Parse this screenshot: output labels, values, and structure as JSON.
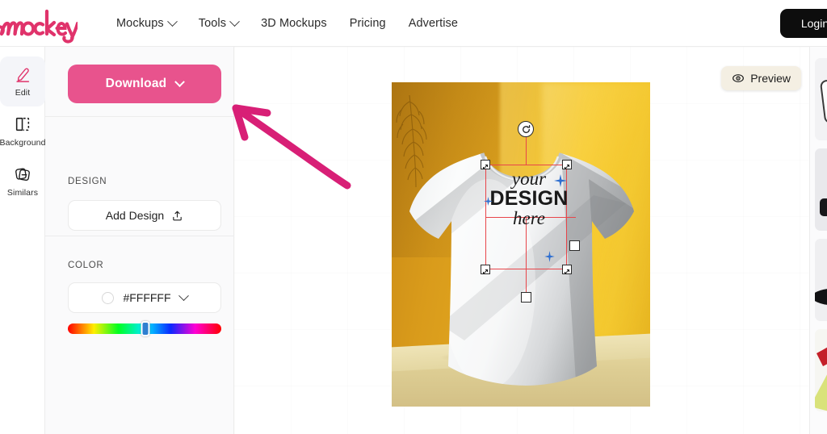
{
  "header": {
    "logo_text": "mockey",
    "nav": [
      {
        "label": "Mockups",
        "has_caret": true
      },
      {
        "label": "Tools",
        "has_caret": true
      },
      {
        "label": "3D Mockups",
        "has_caret": false
      },
      {
        "label": "Pricing",
        "has_caret": false
      },
      {
        "label": "Advertise",
        "has_caret": false
      }
    ],
    "login_label": "Login"
  },
  "rail": {
    "items": [
      {
        "label": "Edit",
        "icon": "pencil-icon",
        "active": true
      },
      {
        "label": "Background",
        "icon": "background-icon",
        "active": false
      },
      {
        "label": "Similars",
        "icon": "similars-icon",
        "active": false
      }
    ]
  },
  "panel": {
    "download_label": "Download",
    "design_section_label": "DESIGN",
    "add_design_label": "Add Design",
    "color_section_label": "COLOR",
    "color_value": "#FFFFFF",
    "hue_position_percent": 52
  },
  "canvas": {
    "preview_label": "Preview",
    "design_placeholder": {
      "line1": "your",
      "line2": "DESIGN",
      "line3": "here"
    }
  },
  "colors": {
    "brand_pink": "#e8538d",
    "logo_pink": "#e0336b",
    "annotation_pink": "#d81f76",
    "selection_red": "#e8454a",
    "mockup_gold": "#d99b1b",
    "login_black": "#0d0d0d"
  }
}
